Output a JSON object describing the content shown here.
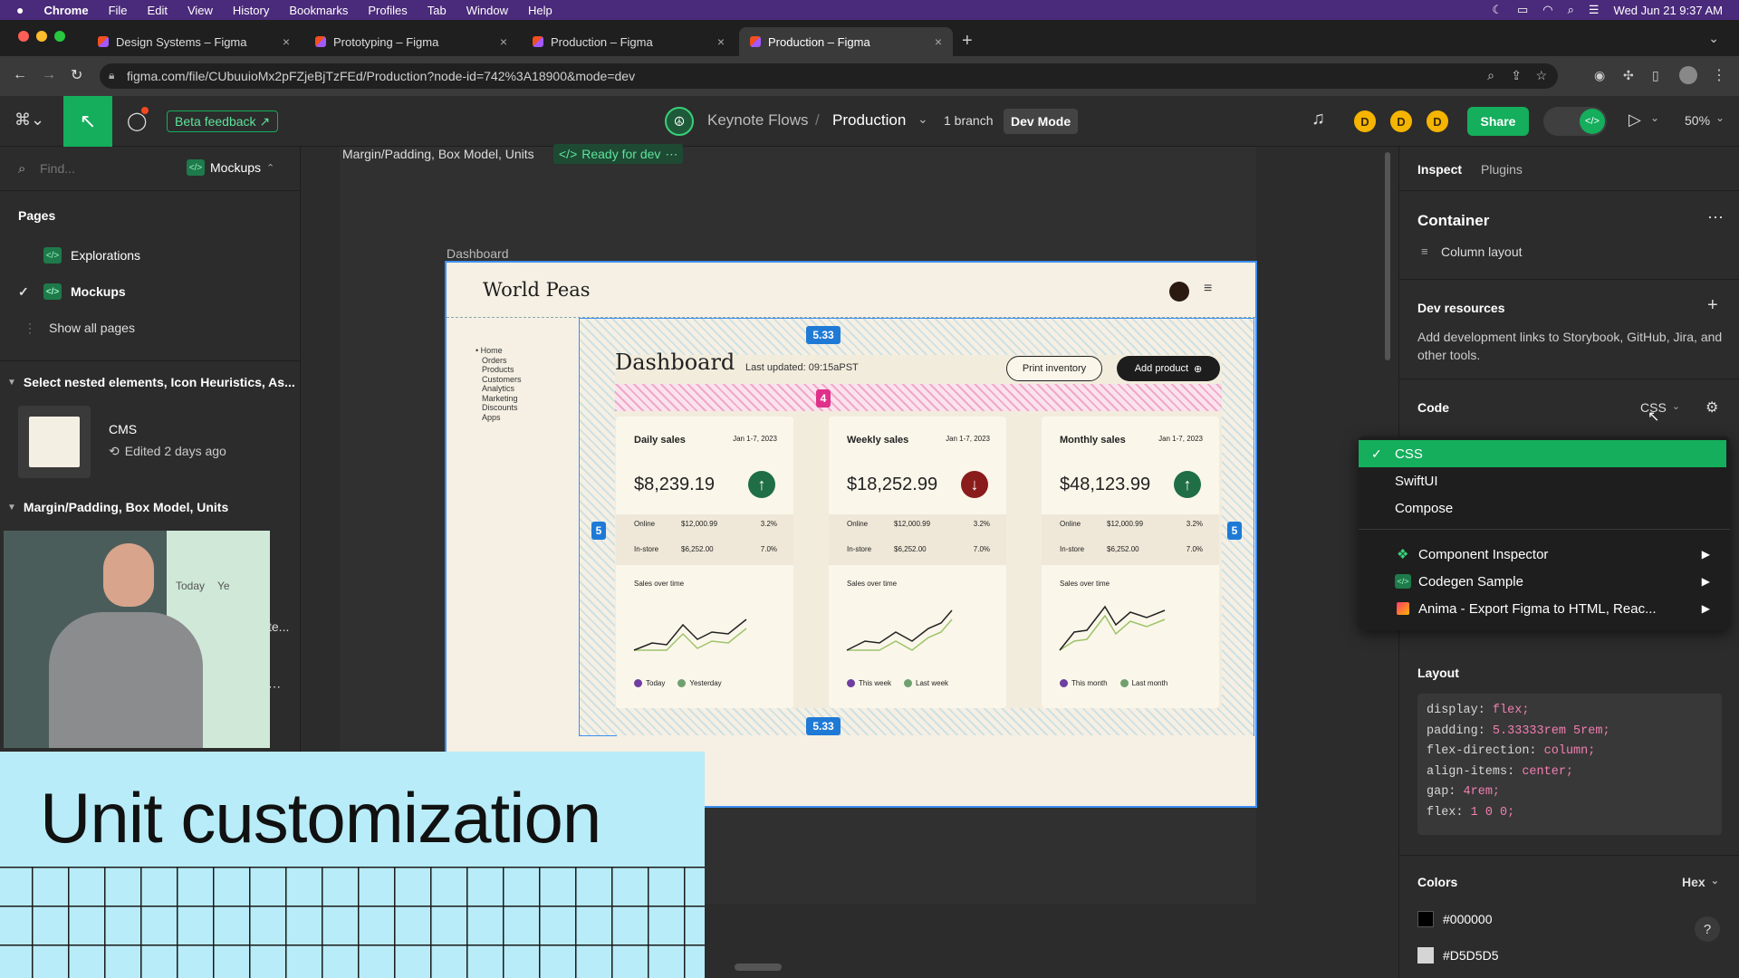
{
  "menubar": {
    "apple": "",
    "app": "Chrome",
    "items": [
      "File",
      "Edit",
      "View",
      "History",
      "Bookmarks",
      "Profiles",
      "Tab",
      "Window",
      "Help"
    ],
    "clock": "Wed Jun 21  9:37 AM"
  },
  "tabs": [
    {
      "label": "Design Systems – Figma"
    },
    {
      "label": "Prototyping – Figma"
    },
    {
      "label": "Production – Figma"
    },
    {
      "label": "Production – Figma"
    }
  ],
  "url": "figma.com/file/CUbuuioMx2pFZjeBjTzFEd/Production?node-id=742%3A18900&mode=dev",
  "toolbar": {
    "beta_feedback": "Beta feedback",
    "project": "Keynote Flows",
    "separator": "/",
    "file": "Production",
    "branch": "1 branch",
    "dev_mode": "Dev Mode",
    "avatars": [
      "D",
      "D",
      "D"
    ],
    "share": "Share",
    "zoom": "50%"
  },
  "left": {
    "search_placeholder": "Find...",
    "page_selector": "Mockups",
    "pages_title": "Pages",
    "pages": [
      "Explorations",
      "Mockups"
    ],
    "show_all": "Show all pages",
    "section1": "Select nested elements, Icon Heuristics, As...",
    "cms_title": "CMS",
    "cms_edited": "Edited 2 days ago",
    "section2": "Margin/Padding, Box Model, Units",
    "peek_text": "te..."
  },
  "canvas": {
    "breadcrumb": "Margin/Padding, Box Model, Units",
    "ready": "Ready for dev",
    "frame_label": "Dashboard",
    "brand": "World Peas",
    "nav": [
      "Home",
      "Orders",
      "Products",
      "Customers",
      "Analytics",
      "Marketing",
      "Discounts",
      "Apps"
    ],
    "dash_title": "Dashboard",
    "last_updated": "Last updated: 09:15aPST",
    "print_btn": "Print inventory",
    "add_btn": "Add product",
    "tag_top": "5.33",
    "tag_bottom": "5.33",
    "tag_gap": "4",
    "tag_left": "5",
    "tag_right": "5",
    "cards": [
      {
        "title": "Daily sales",
        "range": "Jan 1-7, 2023",
        "value": "$8,239.19",
        "trend": "up",
        "online": "$12,000.99",
        "online_pct": "3.2%",
        "instore": "$6,252.00",
        "instore_pct": "7.0%",
        "chart_title": "Sales over time",
        "leg1": "Today",
        "leg2": "Yesterday"
      },
      {
        "title": "Weekly sales",
        "range": "Jan 1-7, 2023",
        "value": "$18,252.99",
        "trend": "down",
        "online": "$12,000.99",
        "online_pct": "3.2%",
        "instore": "$6,252.00",
        "instore_pct": "7.0%",
        "chart_title": "Sales over time",
        "leg1": "This week",
        "leg2": "Last week"
      },
      {
        "title": "Monthly sales",
        "range": "Jan 1-7, 2023",
        "value": "$48,123.99",
        "trend": "up",
        "online": "$12,000.99",
        "online_pct": "3.2%",
        "instore": "$6,252.00",
        "instore_pct": "7.0%",
        "chart_title": "Sales over time",
        "leg1": "This month",
        "leg2": "Last month"
      }
    ],
    "online_label": "Online",
    "instore_label": "In-store"
  },
  "right": {
    "tabs": [
      "Inspect",
      "Plugins"
    ],
    "container": "Container",
    "layout_kind": "Column layout",
    "dev_resources": "Dev resources",
    "dev_desc": "Add development links to Storybook, GitHub, Jira, and other tools.",
    "code_title": "Code",
    "lang": "CSS",
    "layout_title": "Layout",
    "css_lines": [
      {
        "prop": "display:",
        "val": "flex;"
      },
      {
        "prop": "padding:",
        "val": "5.33333rem 5rem;"
      },
      {
        "prop": "flex-direction:",
        "val": "column;"
      },
      {
        "prop": "align-items:",
        "val": "center;"
      },
      {
        "prop": "gap:",
        "val": "4rem;"
      },
      {
        "prop": "flex:",
        "val": "1 0 0;"
      }
    ],
    "colors_title": "Colors",
    "color_format": "Hex",
    "colors": [
      {
        "hex": "#000000"
      },
      {
        "hex": "#D5D5D5"
      }
    ],
    "help": "?"
  },
  "dropdown": {
    "langs": [
      "CSS",
      "SwiftUI",
      "Compose"
    ],
    "plugins": [
      "Component Inspector",
      "Codegen Sample",
      "Anima - Export Figma to HTML, Reac..."
    ]
  },
  "overlay": {
    "caption": "Unit customization",
    "video_legend": [
      "Today",
      "Ye"
    ]
  },
  "colors": {
    "accent": "#14ae5c",
    "blue": "#1f7ad6",
    "pink": "#e0318a",
    "overlay": "#b8ecf8"
  }
}
